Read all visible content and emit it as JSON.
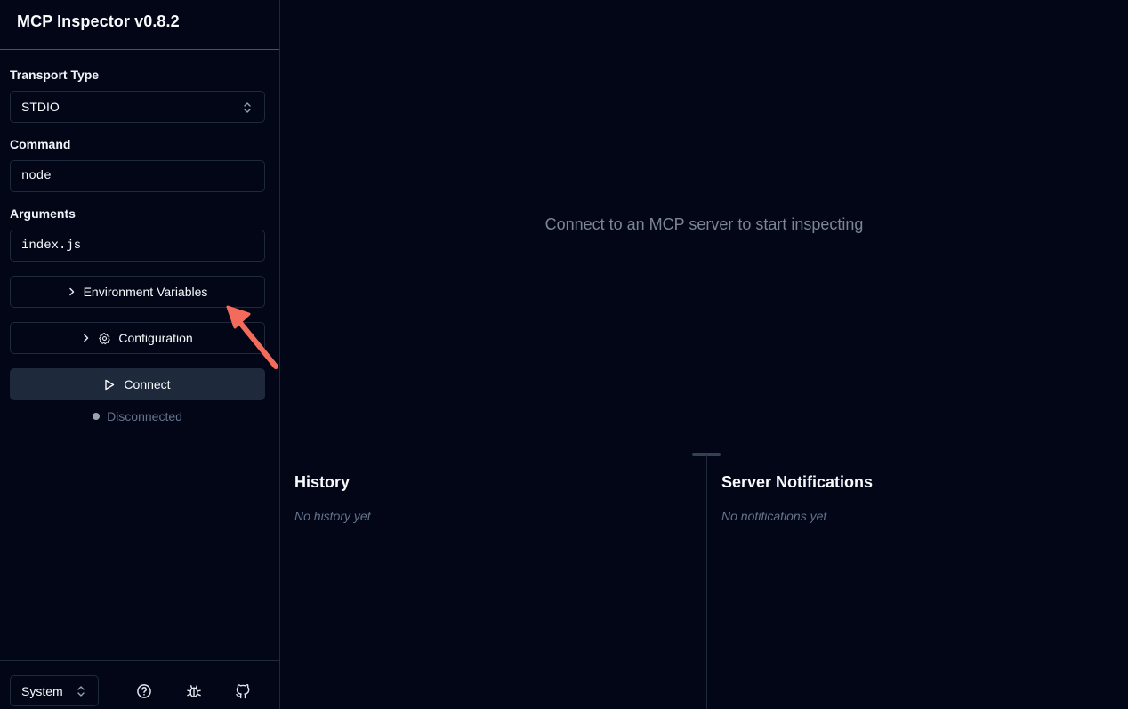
{
  "app": {
    "title": "MCP Inspector v0.8.2"
  },
  "sidebar": {
    "transport": {
      "label": "Transport Type",
      "value": "STDIO"
    },
    "command": {
      "label": "Command",
      "value": "node"
    },
    "arguments": {
      "label": "Arguments",
      "value": "index.js"
    },
    "env_button": "Environment Variables",
    "config_button": "Configuration",
    "connect_button": "Connect",
    "status": "Disconnected"
  },
  "footer": {
    "theme": "System",
    "icons": [
      "help-icon",
      "bug-icon",
      "github-icon"
    ]
  },
  "main": {
    "empty_message": "Connect to an MCP server to start inspecting"
  },
  "history": {
    "title": "History",
    "empty": "No history yet"
  },
  "notifications": {
    "title": "Server Notifications",
    "empty": "No notifications yet"
  },
  "colors": {
    "background": "#020617",
    "border": "#1e293b",
    "annotation_arrow": "#f26b5b"
  }
}
